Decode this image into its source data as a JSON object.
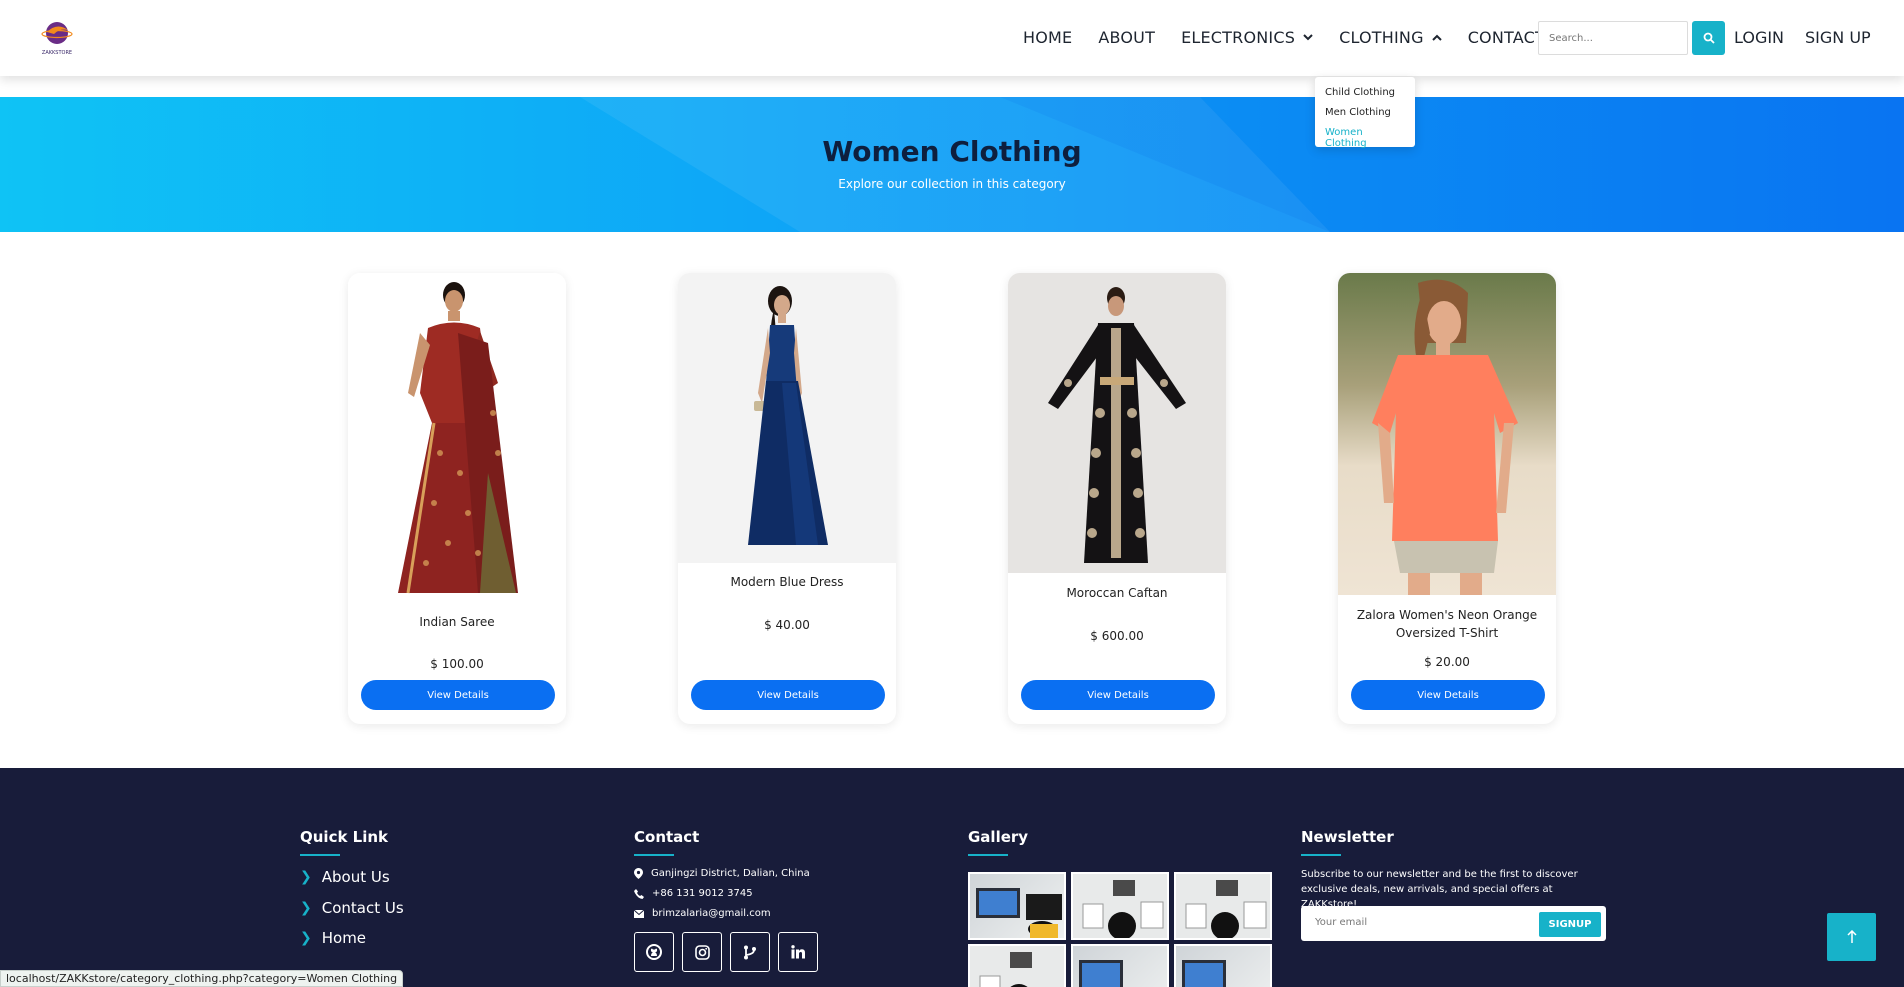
{
  "header": {
    "logo_text": "ZAKKSTORE",
    "nav": [
      {
        "label": "HOME",
        "caret": ""
      },
      {
        "label": "ABOUT",
        "caret": ""
      },
      {
        "label": "ELECTRONICS",
        "caret": "down"
      },
      {
        "label": "CLOTHING",
        "caret": "up"
      },
      {
        "label": "CONTACT",
        "caret": ""
      }
    ],
    "search_placeholder": "Search...",
    "login": "LOGIN",
    "signup": "SIGN UP"
  },
  "dropdown": {
    "items": [
      "Child Clothing",
      "Men Clothing",
      "Women Clothing"
    ],
    "active_index": 2
  },
  "hero": {
    "title": "Women Clothing",
    "subtitle": "Explore our collection in this category"
  },
  "products": [
    {
      "name": "Indian Saree",
      "price": "$ 100.00",
      "button": "View Details"
    },
    {
      "name": "Modern Blue Dress",
      "price": "$ 40.00",
      "button": "View Details"
    },
    {
      "name": "Moroccan Caftan",
      "price": "$ 600.00",
      "button": "View Details"
    },
    {
      "name": "Zalora Women's Neon Orange Oversized T-Shirt",
      "price": "$ 20.00",
      "button": "View Details"
    }
  ],
  "footer": {
    "quick_links": {
      "title": "Quick Link",
      "items": [
        "About Us",
        "Contact Us",
        "Home"
      ]
    },
    "contact": {
      "title": "Contact",
      "address": "Ganjingzi District, Dalian, China",
      "phone": "+86 131 9012 3745",
      "email": "brimzalaria@gmail.com",
      "social_icons": [
        "github-icon",
        "instagram-icon",
        "git-branch-icon",
        "linkedin-icon"
      ]
    },
    "gallery": {
      "title": "Gallery"
    },
    "newsletter": {
      "title": "Newsletter",
      "text": "Subscribe to our newsletter and be the first to discover exclusive deals, new arrivals, and special offers at ZAKKstore!",
      "placeholder": "Your email",
      "button": "SIGNUP"
    }
  },
  "status_bar": "localhost/ZAKKstore/category_clothing.php?category=Women Clothing",
  "colors": {
    "accent": "#17b2c9",
    "primary_button": "#0a6ff2",
    "footer_bg": "#181c3a",
    "hero_title": "#0e1f3e"
  }
}
